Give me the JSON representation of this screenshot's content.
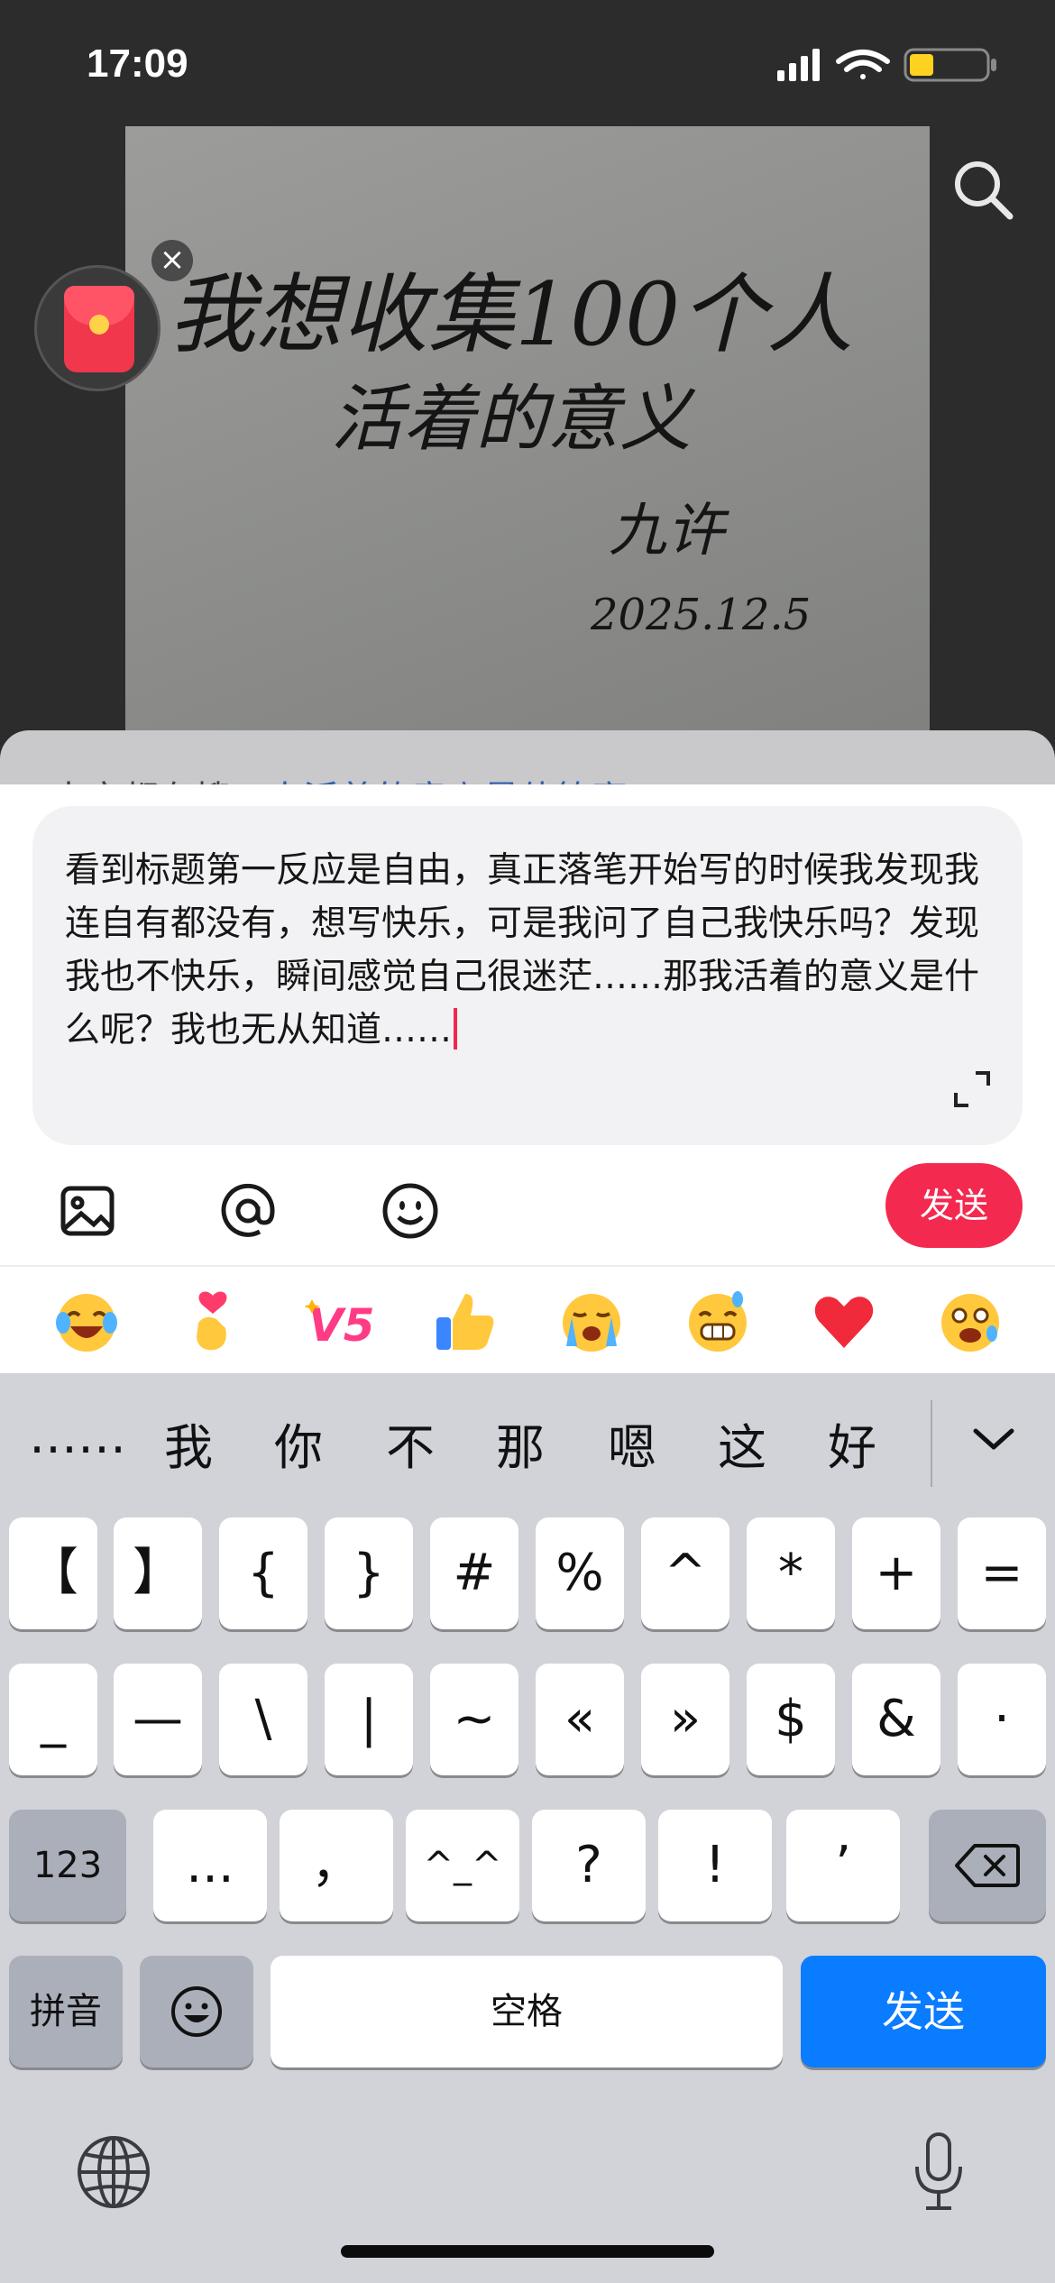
{
  "status_bar": {
    "time": "17:09",
    "battery_color": "#ffd21f"
  },
  "handwriting": {
    "line1": "我想收集100个人",
    "line2": "活着的意义",
    "signature": "九许",
    "date": "2025.12.5"
  },
  "panel_peek": {
    "text_plain": "大家都在搜：",
    "text_link": "人活着的意义最佳答案?"
  },
  "comment": {
    "text": "看到标题第一反应是自由，真正落笔开始写的时候我发现我连自有都没有，想写快乐，可是我问了自己我快乐吗？发现我也不快乐，瞬间感觉自己很迷茫……那我活着的意义是什么呢？我也无从知道……"
  },
  "toolbar": {
    "send_label": "发送",
    "icons": [
      "image-icon",
      "at-icon",
      "emoji-face-icon"
    ],
    "accent": "#f3294f"
  },
  "emoji_row": [
    "laugh-cry-emoji",
    "finger-heart-emoji",
    "v5-emoji",
    "thumbs-up-emoji",
    "crying-emoji",
    "grimace-sweat-emoji",
    "red-heart-emoji",
    "scared-emoji"
  ],
  "keyboard": {
    "candidates": [
      "……",
      "我",
      "你",
      "不",
      "那",
      "嗯",
      "这",
      "好"
    ],
    "row1": [
      "【",
      "】",
      "{",
      "}",
      "#",
      "%",
      "^",
      "*",
      "+",
      "="
    ],
    "row2": [
      "_",
      "—",
      "\\",
      "|",
      "~",
      "«",
      "»",
      "$",
      "&",
      "·"
    ],
    "row3_left": "123",
    "row3": [
      "...",
      "，",
      "^_^",
      "?",
      "!",
      "’"
    ],
    "pinyin_label": "拼音",
    "space_label": "空格",
    "send_label": "发送",
    "send_color": "#0a7cff"
  }
}
